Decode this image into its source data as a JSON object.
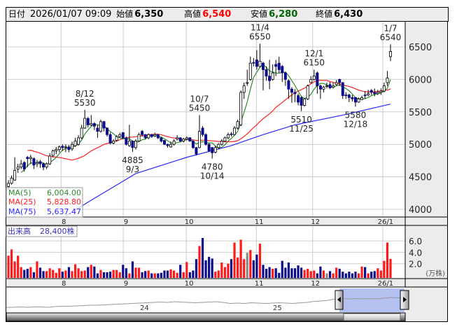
{
  "header": {
    "date_label": "日付",
    "date_value": "2026/01/07 09:09",
    "open_label": "始値",
    "open_value": "6,350",
    "high_label": "高値",
    "high_value": "6,540",
    "low_label": "安値",
    "low_value": "6,280",
    "close_label": "終値",
    "close_value": "6,430"
  },
  "colors": {
    "up_fill": "#ffffff",
    "down_fill": "#0a0a8c",
    "up_vol": "#ff1a1a",
    "down_vol": "#0a0a8c",
    "ma5": "#2e8b2e",
    "ma25": "#ff2020",
    "ma75": "#2828ff",
    "high": "#ff0000",
    "low": "#006400"
  },
  "legend": {
    "ma5_label": "MA(5)",
    "ma5_value": "6,004.00",
    "ma25_label": "MA(25)",
    "ma25_value": "5,828.80",
    "ma75_label": "MA(75)",
    "ma75_value": "5,637.47"
  },
  "volume_panel": {
    "title": "出来高",
    "value": "28,400株",
    "unit": "(万株)"
  },
  "navigator": {
    "year_labels": [
      "24",
      "25"
    ],
    "values": [
      16,
      16,
      17,
      16,
      17,
      17,
      16,
      18,
      19,
      19,
      20,
      21,
      22,
      22,
      23,
      24,
      25,
      26,
      27,
      28,
      29,
      30,
      31,
      30,
      32,
      31,
      30,
      29,
      30,
      31,
      32,
      30,
      27,
      28,
      27,
      29,
      28,
      27,
      28,
      29,
      28,
      27,
      29,
      30,
      33,
      34,
      36,
      40,
      41,
      40,
      41,
      40,
      41,
      40,
      42,
      44,
      43,
      42
    ]
  },
  "chart_data": {
    "type": "candlestick",
    "title": "",
    "price_axis": {
      "ticks": [
        "6500",
        "6000",
        "5500",
        "5000",
        "4500",
        "4000"
      ],
      "tick_values": [
        6500,
        6000,
        5500,
        5000,
        4500,
        4000
      ],
      "range": [
        3880,
        6900
      ]
    },
    "volume_axis": {
      "ticks": [
        "6.0",
        "4.0",
        "2.0"
      ],
      "tick_values": [
        6,
        4,
        2
      ],
      "unit": "万株"
    },
    "month_labels": [
      {
        "label": "8",
        "day": 17
      },
      {
        "label": "9",
        "day": 36.5
      },
      {
        "label": "10",
        "day": 56.3
      },
      {
        "label": "11",
        "day": 78.3
      },
      {
        "label": "12",
        "day": 96
      },
      {
        "label": "26/1",
        "day": 118
      }
    ],
    "annotations": [
      {
        "day": 24,
        "date": "8/12",
        "value": "5530",
        "pos": "above"
      },
      {
        "day": 39,
        "date": "9/3",
        "value": "4885",
        "pos": "below"
      },
      {
        "day": 60,
        "date": "10/7",
        "value": "5450",
        "pos": "above"
      },
      {
        "day": 64,
        "date": "10/14",
        "value": "4780",
        "pos": "below"
      },
      {
        "day": 79,
        "date": "11/4",
        "value": "6550",
        "pos": "above"
      },
      {
        "day": 92,
        "date": "11/25",
        "value": "5510",
        "pos": "below"
      },
      {
        "day": 96,
        "date": "12/1",
        "value": "6150",
        "pos": "above"
      },
      {
        "day": 109,
        "date": "12/18",
        "value": "5580",
        "pos": "below"
      },
      {
        "day": 120,
        "date": "1/7",
        "value": "6540",
        "pos": "above"
      }
    ],
    "ohlc": [
      [
        4350,
        4450,
        4300,
        4400
      ],
      [
        4400,
        4520,
        4380,
        4480
      ],
      [
        4450,
        4800,
        4440,
        4600
      ],
      [
        4620,
        4700,
        4560,
        4650
      ],
      [
        4650,
        4760,
        4620,
        4700
      ],
      [
        4720,
        4740,
        4580,
        4620
      ],
      [
        4800,
        4820,
        4650,
        4780
      ],
      [
        4780,
        4840,
        4700,
        4800
      ],
      [
        4780,
        4800,
        4620,
        4680
      ],
      [
        4700,
        4760,
        4650,
        4720
      ],
      [
        4730,
        4760,
        4640,
        4700
      ],
      [
        4700,
        4720,
        4600,
        4650
      ],
      [
        4650,
        4720,
        4620,
        4700
      ],
      [
        4700,
        4860,
        4680,
        4820
      ],
      [
        4830,
        4920,
        4800,
        4900
      ],
      [
        4900,
        4960,
        4850,
        4920
      ],
      [
        4920,
        4980,
        4880,
        4960
      ],
      [
        4970,
        5000,
        4900,
        4950
      ],
      [
        4950,
        5000,
        4880,
        4960
      ],
      [
        4960,
        4990,
        4880,
        4920
      ],
      [
        4930,
        5040,
        4900,
        5000
      ],
      [
        4980,
        5100,
        4960,
        5050
      ],
      [
        5000,
        5140,
        4980,
        5100
      ],
      [
        5100,
        5300,
        5080,
        5250
      ],
      [
        5250,
        5530,
        5240,
        5400
      ],
      [
        5400,
        5420,
        5260,
        5300
      ],
      [
        5300,
        5450,
        5280,
        5320
      ],
      [
        5320,
        5340,
        5220,
        5280
      ],
      [
        5250,
        5300,
        5100,
        5200
      ],
      [
        5200,
        5380,
        5180,
        5350
      ],
      [
        5350,
        5360,
        5200,
        5250
      ],
      [
        5250,
        5260,
        5120,
        5150
      ],
      [
        5150,
        5180,
        5000,
        5020
      ],
      [
        5020,
        5080,
        5000,
        5050
      ],
      [
        5060,
        5140,
        5040,
        5120
      ],
      [
        5120,
        5180,
        5100,
        5150
      ],
      [
        5180,
        5190,
        5080,
        5100
      ],
      [
        5100,
        5120,
        4980,
        5000
      ],
      [
        4980,
        5300,
        4960,
        5050
      ],
      [
        5050,
        5060,
        4885,
        4950
      ],
      [
        4950,
        5080,
        4920,
        5050
      ],
      [
        5050,
        5180,
        5040,
        5150
      ],
      [
        5200,
        5220,
        5120,
        5150
      ],
      [
        5150,
        5160,
        5080,
        5100
      ],
      [
        5100,
        5170,
        5080,
        5150
      ],
      [
        5150,
        5160,
        5100,
        5120
      ],
      [
        5130,
        5180,
        5110,
        5150
      ],
      [
        5150,
        5160,
        5080,
        5100
      ],
      [
        5100,
        5110,
        5030,
        5050
      ],
      [
        5060,
        5070,
        4990,
        5000
      ],
      [
        5000,
        5010,
        4950,
        4980
      ],
      [
        4960,
        5040,
        4950,
        5000
      ],
      [
        5000,
        5080,
        4980,
        5050
      ],
      [
        5080,
        5140,
        5060,
        5100
      ],
      [
        5100,
        5110,
        5040,
        5050
      ],
      [
        5050,
        5100,
        5030,
        5080
      ],
      [
        5080,
        5120,
        5060,
        5100
      ],
      [
        5100,
        5110,
        5040,
        5050
      ],
      [
        5050,
        5060,
        4930,
        4950
      ],
      [
        4950,
        4960,
        4830,
        4850
      ],
      [
        4950,
        5450,
        4940,
        5200
      ],
      [
        5250,
        5280,
        5120,
        5150
      ],
      [
        5150,
        5170,
        4980,
        5000
      ],
      [
        5000,
        5020,
        4880,
        4900
      ],
      [
        4950,
        4960,
        4780,
        4870
      ],
      [
        4880,
        4980,
        4860,
        4950
      ],
      [
        4950,
        5020,
        4930,
        5000
      ],
      [
        5000,
        5080,
        4980,
        5050
      ],
      [
        5050,
        5120,
        5030,
        5100
      ],
      [
        5100,
        5180,
        5080,
        5150
      ],
      [
        5160,
        5190,
        5120,
        5150
      ],
      [
        5150,
        5280,
        5140,
        5250
      ],
      [
        5250,
        5380,
        5230,
        5350
      ],
      [
        5300,
        5830,
        5280,
        5800
      ],
      [
        5800,
        5950,
        5700,
        5900
      ],
      [
        5950,
        6150,
        5900,
        5950
      ],
      [
        6000,
        6350,
        5980,
        6250
      ],
      [
        6260,
        6330,
        6200,
        6250
      ],
      [
        6300,
        6450,
        6150,
        6200
      ],
      [
        6200,
        6550,
        6180,
        6280
      ],
      [
        6250,
        6270,
        5830,
        6150
      ],
      [
        6150,
        6200,
        5980,
        6050
      ],
      [
        6050,
        6300,
        5850,
        5980
      ],
      [
        6000,
        6230,
        5980,
        6100
      ],
      [
        6230,
        6300,
        6050,
        6200
      ],
      [
        6250,
        6350,
        6100,
        6150
      ],
      [
        6200,
        6220,
        5960,
        6100
      ],
      [
        6100,
        6120,
        5900,
        6000
      ],
      [
        5980,
        6000,
        5700,
        5850
      ],
      [
        5850,
        5880,
        5640,
        5800
      ],
      [
        5800,
        5850,
        5650,
        5780
      ],
      [
        5750,
        5780,
        5600,
        5650
      ],
      [
        5720,
        5740,
        5510,
        5600
      ],
      [
        5600,
        5710,
        5580,
        5700
      ],
      [
        5700,
        5920,
        5680,
        5900
      ],
      [
        5950,
        6050,
        5940,
        6000
      ],
      [
        6000,
        6150,
        5980,
        6050
      ],
      [
        6100,
        6120,
        5780,
        5900
      ],
      [
        5900,
        5920,
        5700,
        5850
      ],
      [
        5850,
        5900,
        5800,
        5880
      ],
      [
        5900,
        5950,
        5860,
        5900
      ],
      [
        5920,
        5960,
        5850,
        5870
      ],
      [
        5880,
        5950,
        5860,
        5900
      ],
      [
        5920,
        5990,
        5900,
        5950
      ],
      [
        6000,
        6010,
        5900,
        5950
      ],
      [
        5950,
        5960,
        5700,
        5750
      ],
      [
        5760,
        5800,
        5700,
        5750
      ],
      [
        5760,
        5780,
        5650,
        5720
      ],
      [
        5720,
        5760,
        5660,
        5700
      ],
      [
        5720,
        5730,
        5580,
        5650
      ],
      [
        5650,
        5720,
        5640,
        5700
      ],
      [
        5690,
        5750,
        5680,
        5720
      ],
      [
        5760,
        5820,
        5700,
        5750
      ],
      [
        5760,
        5840,
        5740,
        5780
      ],
      [
        5830,
        5850,
        5760,
        5800
      ],
      [
        5800,
        5860,
        5740,
        5780
      ],
      [
        5780,
        5840,
        5760,
        5800
      ],
      [
        5800,
        5860,
        5760,
        5820
      ],
      [
        5820,
        5950,
        5800,
        5900
      ],
      [
        5950,
        6130,
        5900,
        6020
      ],
      [
        6350,
        6540,
        6280,
        6430
      ]
    ],
    "volume": [
      3.4,
      4.5,
      2.4,
      3.4,
      1.4,
      0.9,
      1.1,
      1.4,
      0.5,
      2.4,
      1.3,
      0.7,
      0.7,
      1.2,
      0.9,
      0.4,
      1.2,
      0.6,
      0.8,
      1.4,
      0.7,
      1.9,
      1.2,
      0.7,
      0.8,
      1.4,
      1.8,
      1.5,
      0.3,
      0.9,
      0.5,
      0.5,
      0.6,
      0.9,
      0.9,
      0.5,
      1.8,
      1.2,
      0.3,
      2.4,
      1.3,
      1.3,
      0.5,
      0.7,
      0.8,
      0.3,
      0.3,
      0.3,
      0.4,
      0.8,
      0.8,
      1.0,
      0.8,
      0.4,
      1.8,
      0.5,
      2.3,
      0.5,
      0.8,
      2.8,
      5.1,
      6.5,
      2.6,
      3.2,
      2.9,
      0.6,
      0.8,
      2.2,
      1.4,
      2.0,
      2.8,
      5.7,
      3.1,
      6.2,
      2.8,
      3.9,
      4.4,
      2.6,
      3.6,
      5.5,
      1.8,
      1.1,
      1.4,
      1.1,
      1.2,
      0.4,
      2.5,
      1.3,
      2.2,
      1.2,
      1.2,
      1.7,
      1.3,
      0.9,
      1.1,
      0.7,
      0.8,
      0.3,
      1.5,
      0.8,
      0.3,
      0.7,
      0.3,
      1.3,
      1.1,
      0.6,
      0.3,
      0.6,
      0.3,
      0.6,
      0.3,
      1.5,
      1.4,
      0.3,
      0.6,
      0.7,
      1.2,
      0.8,
      2.5,
      5.7,
      2.84
    ],
    "ma75_points": [
      [
        18,
        3900
      ],
      [
        24,
        4080
      ],
      [
        40,
        4550
      ],
      [
        56,
        4800
      ],
      [
        70,
        4980
      ],
      [
        80,
        5150
      ],
      [
        90,
        5300
      ],
      [
        105,
        5450
      ],
      [
        120,
        5620
      ]
    ]
  }
}
